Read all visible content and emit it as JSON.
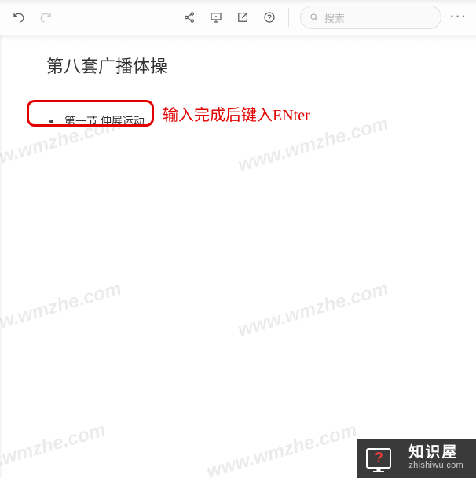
{
  "toolbar": {
    "search_placeholder": "搜索",
    "more_label": "···"
  },
  "document": {
    "title": "第八套广播体操",
    "list": [
      {
        "text": "第一节 伸展运动"
      }
    ]
  },
  "annotation": {
    "text": "输入完成后键入ENter"
  },
  "watermark": {
    "text": "www.wmzhe.com"
  },
  "brand": {
    "cn": "知识屋",
    "en": "zhishiwu.com",
    "q": "?"
  }
}
